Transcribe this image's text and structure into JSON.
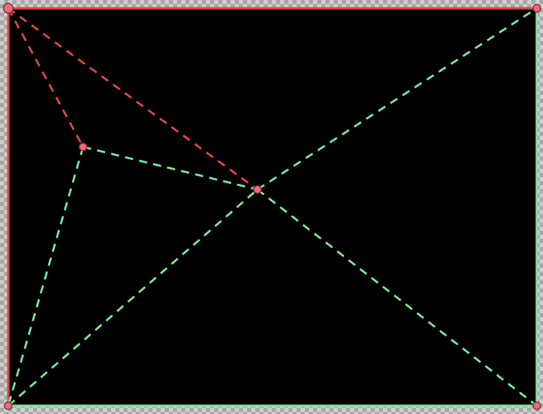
{
  "diagram": {
    "canvas_color": "#000000",
    "dark_frame_color": "#2a2218",
    "colors": {
      "red": "#e04848",
      "green": "#7de8a0",
      "node_fill": "#f26a78",
      "node_stroke": "#7a2a30"
    }
  }
}
